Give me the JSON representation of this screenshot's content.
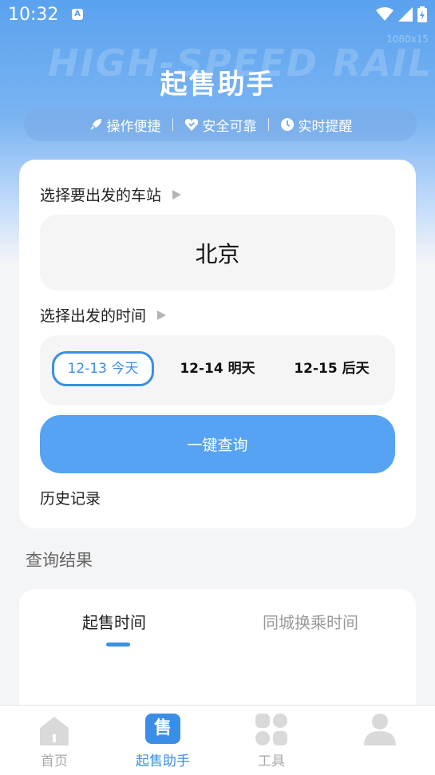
{
  "status_bar": {
    "time": "10:32",
    "notif_glyph": "A"
  },
  "header": {
    "watermark": "HIGH-SPEED RAIL",
    "watermark_small": "1080x15",
    "title": "起售助手",
    "features": [
      {
        "icon": "rocket-icon",
        "label": "操作便捷"
      },
      {
        "icon": "heart-shield-icon",
        "label": "安全可靠"
      },
      {
        "icon": "clock-icon",
        "label": "实时提醒"
      }
    ]
  },
  "form": {
    "station_label": "选择要出发的车站",
    "station_value": "北京",
    "time_label": "选择出发的时间",
    "dates": [
      {
        "label": "12-13 今天",
        "selected": true
      },
      {
        "label": "12-14 明天",
        "selected": false
      },
      {
        "label": "12-15 后天",
        "selected": false
      }
    ],
    "query_button": "一键查询",
    "history_link": "历史记录"
  },
  "results": {
    "title": "查询结果",
    "tabs": [
      {
        "label": "起售时间",
        "active": true
      },
      {
        "label": "同城换乘时间",
        "active": false
      }
    ]
  },
  "bottom_nav": [
    {
      "icon": "home-icon",
      "label": "首页",
      "active": false
    },
    {
      "icon": "ticket-icon",
      "label": "起售助手",
      "active": true,
      "icon_text": "售"
    },
    {
      "icon": "grid-icon",
      "label": "工具",
      "active": false
    },
    {
      "icon": "user-icon",
      "label": "",
      "active": false
    }
  ],
  "colors": {
    "accent": "#3a8ee6",
    "button": "#55a3f2",
    "hero": "#5aa2ef"
  }
}
